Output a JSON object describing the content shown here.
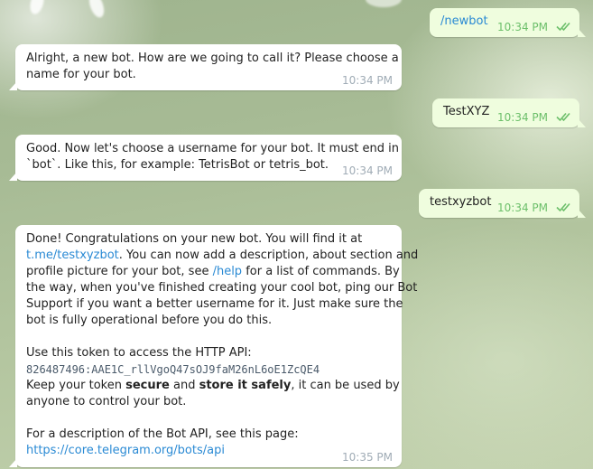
{
  "messages": {
    "m1": {
      "text": "/newbot",
      "time": "10:34 PM"
    },
    "m2": {
      "line1": "Alright, a new bot. How are we going to call it? Please choose a",
      "line2": "name for your bot.",
      "time": "10:34 PM"
    },
    "m3": {
      "text": "TestXYZ",
      "time": "10:34 PM"
    },
    "m4": {
      "line1": "Good. Now let's choose a username for your bot. It must end in",
      "line2": "`bot`. Like this, for example: TetrisBot or tetris_bot.",
      "time": "10:34 PM"
    },
    "m5": {
      "text": "testxyzbot",
      "time": "10:34 PM"
    },
    "m6": {
      "l1": "Done! Congratulations on your new bot. You will find it at",
      "l2_link": "t.me/testxyzbot",
      "l2_rest": ". You can now add a description, about section and",
      "l3_a": "profile picture for your bot, see ",
      "l3_link": "/help",
      "l3_b": " for a list of commands. By",
      "l4": "the way, when you've finished creating your cool bot, ping our Bot",
      "l5": "Support if you want a better username for it. Just make sure the",
      "l6": "bot is fully operational before you do this.",
      "l7": "Use this token to access the HTTP API:",
      "token": "826487496:AAE1C_rllVgoQ47sOJ9faM26nL6oE1ZcQE4",
      "l9_a": "Keep your token ",
      "l9_b1": "secure",
      "l9_c": " and ",
      "l9_b2": "store it safely",
      "l9_d": ", it can be used by",
      "l10": "anyone to control your bot.",
      "l11": "For a description of the Bot API, see this page:",
      "l12_link": "https://core.telegram.org/bots/api",
      "time": "10:35 PM"
    }
  },
  "colors": {
    "incoming_bg": "#ffffff",
    "outgoing_bg": "#effdde",
    "link": "#2a8ad4",
    "outgoing_time": "#6cbf6a",
    "incoming_time": "#a0acb6"
  },
  "icons": {
    "read_receipt": "double-check-icon"
  }
}
